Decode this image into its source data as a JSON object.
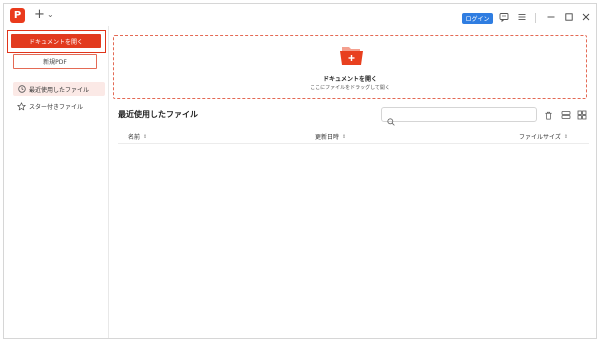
{
  "titlebar": {
    "logo_letter": "P",
    "add_tab_label": "+",
    "add_tab_menu": "⌄",
    "login_label": "ログイン"
  },
  "sidebar": {
    "open_document_label": "ドキュメントを開く",
    "new_pdf_label": "新規PDF",
    "items": [
      {
        "label": "最近使用したファイル",
        "icon": "clock-icon",
        "active": true
      },
      {
        "label": "スター付きファイル",
        "icon": "star-icon",
        "active": false
      }
    ]
  },
  "dropzone": {
    "title": "ドキュメントを開く",
    "subtitle": "ここにファイルをドラッグして開く"
  },
  "recent": {
    "title": "最近使用したファイル",
    "search_value": "",
    "search_placeholder": "",
    "columns": [
      {
        "label": "名前",
        "sort_indicator": "⇕"
      },
      {
        "label": "更新日時",
        "sort_indicator": "⇕"
      },
      {
        "label": "ファイルサイズ",
        "sort_indicator": "⇕"
      }
    ],
    "rows": []
  },
  "colors": {
    "accent": "#e23a1e",
    "login_blue": "#2f7de1",
    "active_bg": "#fbe9e6"
  }
}
